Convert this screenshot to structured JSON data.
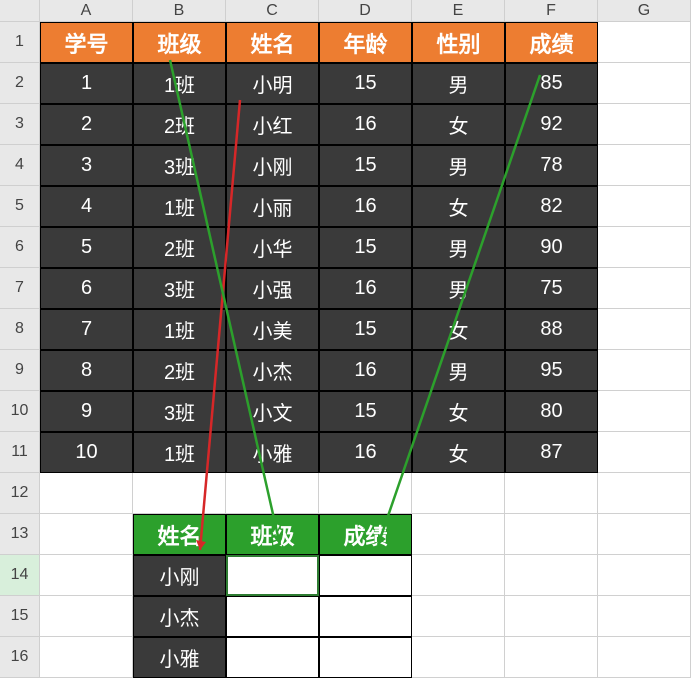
{
  "columns": [
    "A",
    "B",
    "C",
    "D",
    "E",
    "F",
    "G"
  ],
  "rowNumbers": [
    "1",
    "2",
    "3",
    "4",
    "5",
    "6",
    "7",
    "8",
    "9",
    "10",
    "11",
    "12",
    "13",
    "14",
    "15",
    "16"
  ],
  "main": {
    "headers": [
      "学号",
      "班级",
      "姓名",
      "年龄",
      "性别",
      "成绩"
    ],
    "rows": [
      [
        "1",
        "1班",
        "小明",
        "15",
        "男",
        "85"
      ],
      [
        "2",
        "2班",
        "小红",
        "16",
        "女",
        "92"
      ],
      [
        "3",
        "3班",
        "小刚",
        "15",
        "男",
        "78"
      ],
      [
        "4",
        "1班",
        "小丽",
        "16",
        "女",
        "82"
      ],
      [
        "5",
        "2班",
        "小华",
        "15",
        "男",
        "90"
      ],
      [
        "6",
        "3班",
        "小强",
        "16",
        "男",
        "75"
      ],
      [
        "7",
        "1班",
        "小美",
        "15",
        "女",
        "88"
      ],
      [
        "8",
        "2班",
        "小杰",
        "16",
        "男",
        "95"
      ],
      [
        "9",
        "3班",
        "小文",
        "15",
        "女",
        "80"
      ],
      [
        "10",
        "1班",
        "小雅",
        "16",
        "女",
        "87"
      ]
    ]
  },
  "lookup": {
    "headers": [
      "姓名",
      "班级",
      "成绩"
    ],
    "names": [
      "小刚",
      "小杰",
      "小雅"
    ]
  }
}
